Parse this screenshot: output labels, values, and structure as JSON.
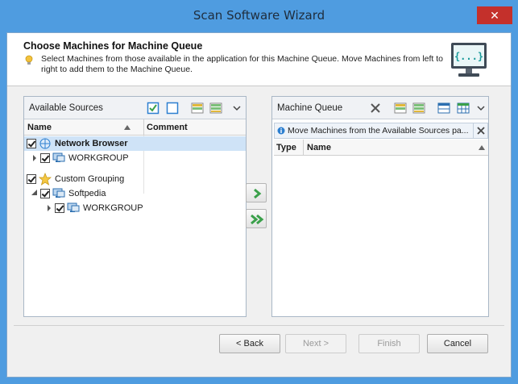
{
  "window": {
    "title": "Scan Software Wizard",
    "close_glyph": "✕"
  },
  "header": {
    "title": "Choose Machines for Machine Queue",
    "description": "Select Machines from those available in the application for this Machine Queue. Move Machines from left to right to add them to the Machine Queue.",
    "monitor_glyph": "{...}"
  },
  "left_panel": {
    "title": "Available Sources",
    "columns": {
      "name": "Name",
      "comment": "Comment"
    },
    "tree": [
      {
        "label": "Network Browser",
        "icon": "network-browser-icon"
      },
      {
        "label": "WORKGROUP",
        "icon": "computer-icon"
      },
      {
        "label": "Custom Grouping",
        "icon": "star-icon"
      },
      {
        "label": "Softpedia",
        "icon": "computer-icon"
      },
      {
        "label": "WORKGROUP",
        "icon": "computer-icon"
      }
    ]
  },
  "right_panel": {
    "title": "Machine Queue",
    "info": "Move Machines from the Available Sources pa...",
    "columns": {
      "type": "Type",
      "name": "Name"
    }
  },
  "footer": {
    "back": "< Back",
    "next": "Next >",
    "finish": "Finish",
    "cancel": "Cancel"
  },
  "colors": {
    "titlebar": "#4f9ce0",
    "accent_green": "#3aa04a",
    "selection": "#cfe3f7"
  }
}
